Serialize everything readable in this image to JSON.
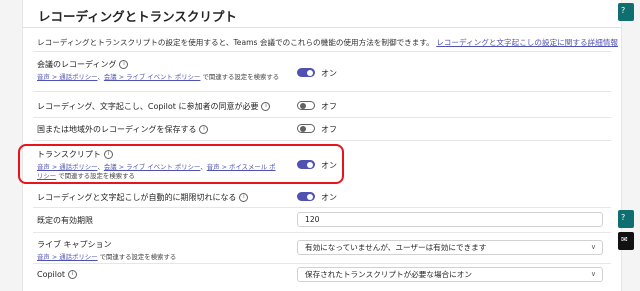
{
  "section": {
    "title": "レコーディングとトランスクリプト",
    "description": "レコーディングとトランスクリプトの設定を使用すると、Teams 会議でのこれらの機能の使用方法を制御できます。",
    "description_link": "レコーディングと文字起こしの設定に関する詳細情報"
  },
  "settings": {
    "meeting_recording": {
      "label": "会議のレコーディング",
      "link1": "音声 > 通話ポリシー",
      "sep": "、",
      "link2": "会議 > ライブ イベント ポリシー",
      "suffix": " で関連する設定を検索する",
      "state": "オン"
    },
    "consent": {
      "label": "レコーディング、文字起こし、Copilot に参加者の同意が必要",
      "state": "オフ"
    },
    "outside_region": {
      "label": "国または地域外のレコーディングを保存する",
      "state": "オフ"
    },
    "transcript": {
      "label": "トランスクリプト",
      "link1": "音声 > 通話ポリシー",
      "sep1": "、",
      "link2": "会議 > ライブ イベント ポリシー",
      "sep2": "、",
      "link3a": "音声 > ボイスメール ポ",
      "link3b": "リシー",
      "suffix": " で関連する設定を検索する",
      "state": "オン"
    },
    "auto_expire": {
      "label": "レコーディングと文字起こしが自動的に期限切れになる",
      "state": "オン"
    },
    "default_expiration": {
      "label": "既定の有効期限",
      "value": "120"
    },
    "live_captions": {
      "label": "ライブ キャプション",
      "link": "音声 > 通話ポリシー",
      "suffix": " で関連する設定を検索する",
      "value": "有効になっていませんが、ユーザーは有効にできます"
    },
    "copilot": {
      "label": "Copilot",
      "value": "保存されたトランスクリプトが必要な場合にオン"
    }
  },
  "icons": {
    "info": "i",
    "chevron": "∨",
    "feedback": "✉",
    "help": "?"
  }
}
